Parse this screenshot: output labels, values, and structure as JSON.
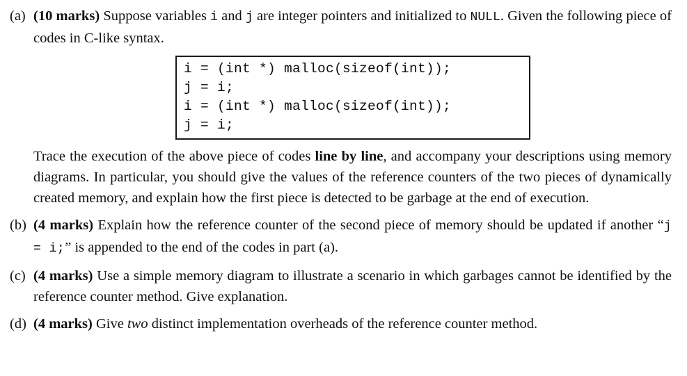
{
  "document": {
    "type": "exam-question",
    "ink_color": "#111111",
    "paper_color": "#ffffff"
  },
  "questions": [
    {
      "label": "(a)",
      "marks_label": "(10 marks)",
      "intro_before_i": " Suppose variables ",
      "var_i": "i",
      "between_i_and_j": " and ",
      "var_j": "j",
      "after_j": " are integer pointers and initialized to ",
      "null_literal": "NULL",
      "after_null": ". Given the following piece of codes in C-like syntax.",
      "code_lines": [
        "i = (int *) malloc(sizeof(int));",
        "j = i;",
        "i = (int *) malloc(sizeof(int));",
        "j = i;"
      ],
      "trace_before_bold": "Trace the execution of the above piece of codes ",
      "trace_bold": "line by line",
      "trace_after_bold": ", and accompany your descriptions using memory diagrams.  In particular, you should give the values of the reference counters of the two pieces of dynamically created memory, and explain how the first piece is detected to be garbage at the end of execution."
    },
    {
      "label": "(b)",
      "marks_label": "(4 marks)",
      "text_before_code": " Explain how the reference counter of the second piece of memory should be updated if another “",
      "inline_code": "j  =  i;",
      "text_after_code": "” is appended to the end of the codes in part (a)."
    },
    {
      "label": "(c)",
      "marks_label": "(4 marks)",
      "text": " Use a simple memory diagram to illustrate a scenario in which garbages cannot be identified by the reference counter method. Give explanation."
    },
    {
      "label": "(d)",
      "marks_label": "(4 marks)",
      "text_before_italic": " Give ",
      "italic_word": "two",
      "text_after_italic": " distinct implementation overheads of the reference counter method."
    }
  ]
}
